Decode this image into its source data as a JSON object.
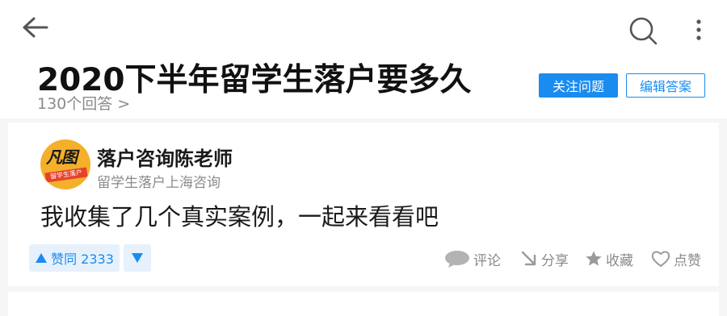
{
  "header": {
    "back_icon": "arrow-left-icon",
    "search_icon": "search-icon",
    "more_icon": "more-vertical-icon"
  },
  "question": {
    "title": "2020下半年留学生落户要多久",
    "answer_count": "130个回答 >",
    "follow_label": "关注问题",
    "edit_label": "编辑答案"
  },
  "answer": {
    "avatar": {
      "logo_text": "凡图",
      "ribbon_text": "留学生落户"
    },
    "author_name": "落户咨询陈老师",
    "author_bio": "留学生落户上海咨询",
    "excerpt": "我收集了几个真实案例，一起来看看吧",
    "vote_label": "赞同 2333",
    "actions": {
      "comment": "评论",
      "share": "分享",
      "favorite": "收藏",
      "thanks": "点赞"
    }
  },
  "colors": {
    "accent": "#1a8cf0",
    "muted": "#8a8a8a",
    "background": "#f6f6f6"
  }
}
